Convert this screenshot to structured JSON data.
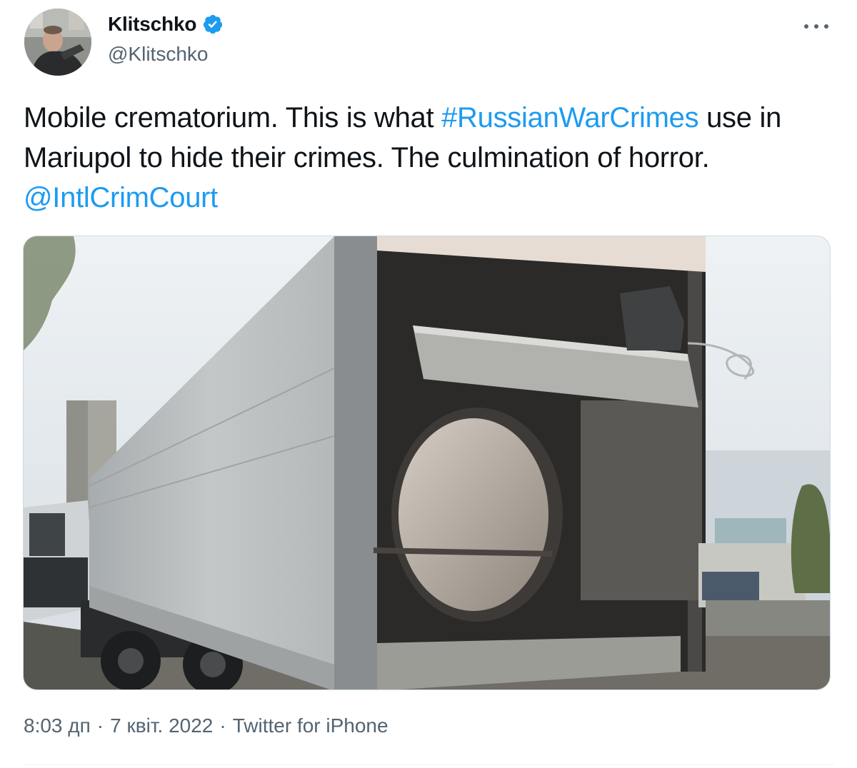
{
  "author": {
    "display_name": "Klitschko",
    "handle": "@Klitschko",
    "verified": true
  },
  "tweet": {
    "text_parts": [
      {
        "type": "text",
        "value": "Mobile crematorium. This is what "
      },
      {
        "type": "hashtag",
        "value": "#RussianWarCrimes"
      },
      {
        "type": "text",
        "value": " use in Mariupol to hide their crimes. The culmination of horror. "
      },
      {
        "type": "mention",
        "value": "@IntlCrimCourt"
      }
    ]
  },
  "meta": {
    "time": "8:03 дп",
    "date": "7 квіт. 2022",
    "source": "Twitter for iPhone",
    "separator": "·"
  },
  "icons": {
    "verified": "verified-badge-icon",
    "more": "more-horizontal-icon"
  },
  "colors": {
    "link": "#1d9bf0",
    "secondary_text": "#536471",
    "primary_text": "#0f1419",
    "border": "#cfd9de"
  }
}
